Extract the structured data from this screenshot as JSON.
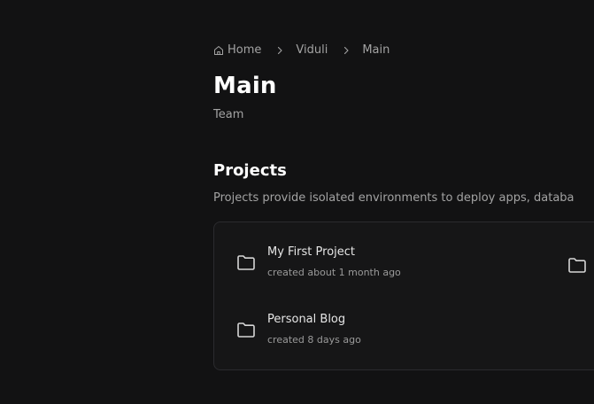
{
  "breadcrumb": {
    "items": [
      {
        "label": "Home",
        "icon": "home-icon"
      },
      {
        "label": "Viduli"
      },
      {
        "label": "Main"
      }
    ]
  },
  "header": {
    "title": "Main",
    "subtitle": "Team"
  },
  "projects_section": {
    "title": "Projects",
    "description": "Projects provide isolated environments to deploy apps, databa"
  },
  "projects": [
    {
      "name": "My First Project",
      "meta": "created about 1 month ago",
      "icon": "folder-icon"
    },
    {
      "name": "Personal Blog",
      "meta": "created 8 days ago",
      "icon": "folder-icon"
    }
  ],
  "colors": {
    "background": "#121213",
    "card": "#161617",
    "border": "#2b2b2e",
    "text_primary": "#ffffff",
    "text_secondary": "#a3a3a3"
  }
}
